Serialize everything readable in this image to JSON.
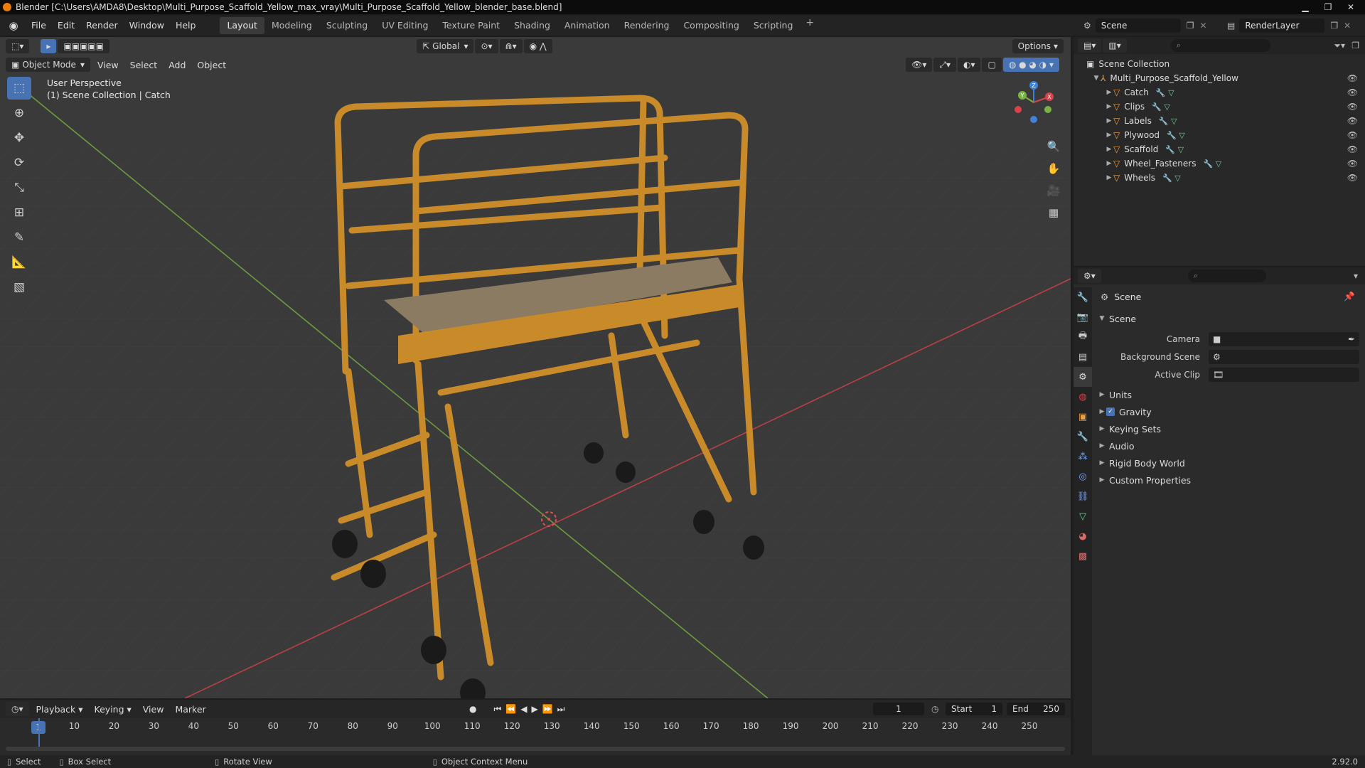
{
  "window": {
    "title": "Blender [C:\\Users\\AMDA8\\Desktop\\Multi_Purpose_Scaffold_Yellow_max_vray\\Multi_Purpose_Scaffold_Yellow_blender_base.blend]"
  },
  "topbar": {
    "menus": [
      "File",
      "Edit",
      "Render",
      "Window",
      "Help"
    ],
    "workspaces": [
      "Layout",
      "Modeling",
      "Sculpting",
      "UV Editing",
      "Texture Paint",
      "Shading",
      "Animation",
      "Rendering",
      "Compositing",
      "Scripting"
    ],
    "active_workspace": "Layout",
    "scene": "Scene",
    "view_layer": "RenderLayer"
  },
  "viewport": {
    "transform_orientation": "Global",
    "options_label": "Options",
    "mode": "Object Mode",
    "menus": [
      "View",
      "Select",
      "Add",
      "Object"
    ],
    "overlay_line1": "User Perspective",
    "overlay_line2": "(1) Scene Collection | Catch",
    "gizmo_axes": {
      "x": "X",
      "y": "Y",
      "z": "Z"
    }
  },
  "outliner": {
    "root": "Scene Collection",
    "collection": "Multi_Purpose_Scaffold_Yellow",
    "objects": [
      "Catch",
      "Clips",
      "Labels",
      "Plywood",
      "Scaffold",
      "Wheel_Fasteners",
      "Wheels"
    ]
  },
  "properties": {
    "title": "Scene",
    "panel": "Scene",
    "fields": {
      "camera_label": "Camera",
      "background_label": "Background Scene",
      "clip_label": "Active Clip"
    },
    "sections": [
      "Units",
      "Gravity",
      "Keying Sets",
      "Audio",
      "Rigid Body World",
      "Custom Properties"
    ],
    "gravity_checked": true
  },
  "timeline": {
    "menus": [
      "Playback",
      "Keying",
      "View",
      "Marker"
    ],
    "current_frame": "1",
    "start_label": "Start",
    "start": "1",
    "end_label": "End",
    "end": "250",
    "ticks": [
      "1",
      "10",
      "20",
      "30",
      "40",
      "50",
      "60",
      "70",
      "80",
      "90",
      "100",
      "110",
      "120",
      "130",
      "140",
      "150",
      "160",
      "170",
      "180",
      "190",
      "200",
      "210",
      "220",
      "230",
      "240",
      "250"
    ]
  },
  "statusbar": {
    "items": [
      "Select",
      "Box Select",
      "Rotate View",
      "Object Context Menu"
    ],
    "version": "2.92.0"
  },
  "colors": {
    "accent": "#4772b3",
    "scaffold": "#c98a2a",
    "axis_x": "#d9424b",
    "axis_y": "#7ab342",
    "axis_z": "#3f82d9"
  }
}
